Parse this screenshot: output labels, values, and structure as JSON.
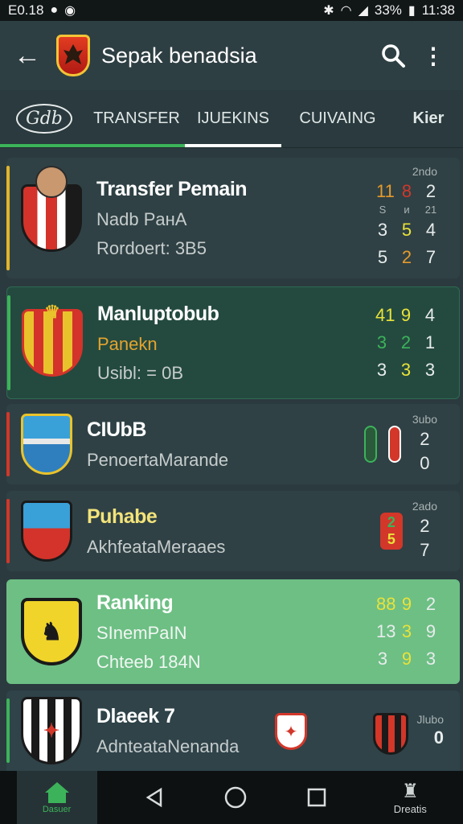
{
  "status_bar": {
    "left_text": "E0.18",
    "battery": "33%",
    "time": "11:38"
  },
  "app_bar": {
    "title": "Sepak benadsia"
  },
  "tabs": [
    {
      "label": "Gdb"
    },
    {
      "label": "TRANSFER"
    },
    {
      "label": "IJUEKINS"
    },
    {
      "label": "CUIVAING"
    },
    {
      "label": "Kier"
    }
  ],
  "cards": [
    {
      "title": "Transfer Pemain",
      "line2": "Nadb PaнA",
      "line3": "Rordoert: 3B5",
      "stat_head": "2ndo",
      "rows": [
        [
          "11",
          "8",
          "2"
        ],
        [
          "S",
          "и",
          "21"
        ],
        [
          "3",
          "5",
          "4"
        ],
        [
          "5",
          "2",
          "7"
        ]
      ]
    },
    {
      "title": "Manluptobub",
      "line2": "Panekn",
      "line3": "Usibl: = 0B",
      "stat_head": "",
      "rows": [
        [
          "41",
          "9",
          "4"
        ],
        [
          "3",
          "2",
          "1"
        ],
        [
          "3",
          "3",
          "3"
        ]
      ]
    },
    {
      "title": "CIUbB",
      "line2": "PenoertaMarande",
      "line3": "",
      "stat_head": "3ubo",
      "rows": [
        [
          "",
          "",
          "2"
        ],
        [
          "",
          "",
          "0"
        ]
      ]
    },
    {
      "title": "Puhabe",
      "line2": "AkhfeataMeraaes",
      "line3": "",
      "stat_head": "2ado",
      "rows": [
        [
          "",
          "2",
          "2"
        ],
        [
          "",
          "5",
          "7"
        ]
      ]
    },
    {
      "title": "Ranking",
      "line2": "SInemPaIN",
      "line3": "Chteeb 184N",
      "stat_head": "",
      "rows": [
        [
          "88",
          "9",
          "2"
        ],
        [
          "13",
          "3",
          "9"
        ],
        [
          "3",
          "9",
          "3"
        ]
      ]
    },
    {
      "title": "Dlaeek 7",
      "line2": "AdnteataNenanda",
      "line3": "",
      "stat_head": "Jlubo",
      "rows": [
        [
          "",
          "",
          "0"
        ]
      ]
    }
  ],
  "bottom_nav": {
    "home_label": "Dasuer",
    "details_label": "Dreatis"
  },
  "colors": {
    "accent_green": "#3cb35a",
    "yellow": "#e9e23a",
    "orange": "#e59a2c",
    "red": "#d2372a"
  }
}
